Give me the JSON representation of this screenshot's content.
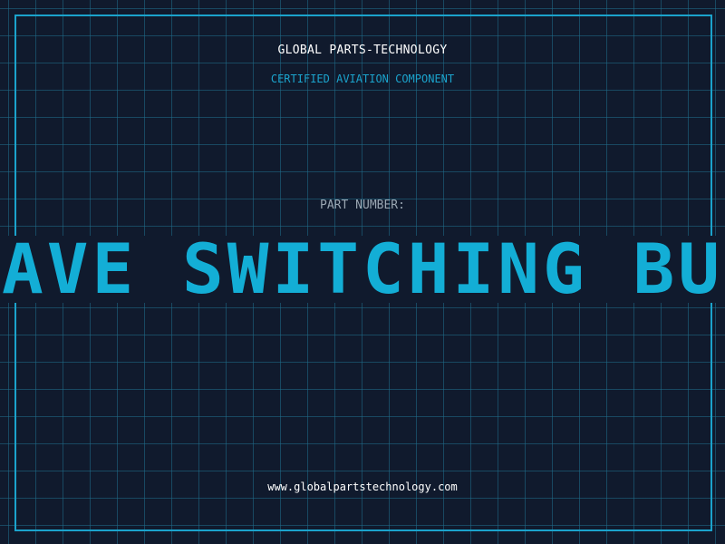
{
  "header": {
    "company": "GLOBAL PARTS-TECHNOLOGY",
    "subtitle": "CERTIFIED AVIATION COMPONENT"
  },
  "part": {
    "label": "PART NUMBER:",
    "name": "WAVE SWITCHING BUS"
  },
  "footer": {
    "website": "www.globalpartstechnology.com"
  },
  "colors": {
    "background": "#101a2d",
    "accent": "#13aed6",
    "grid": "#206e8c"
  }
}
